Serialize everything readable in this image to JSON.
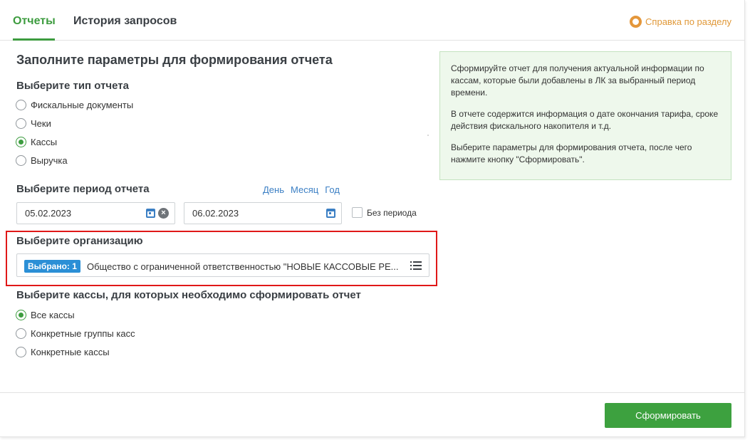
{
  "tabs": [
    {
      "label": "Отчеты",
      "active": true
    },
    {
      "label": "История запросов",
      "active": false
    }
  ],
  "help": {
    "label": "Справка по разделу",
    "icon": "lifebuoy-icon"
  },
  "form": {
    "title": "Заполните параметры для формирования отчета",
    "report_type": {
      "heading": "Выберите тип отчета",
      "options": [
        {
          "label": "Фискальные документы",
          "checked": false
        },
        {
          "label": "Чеки",
          "checked": false
        },
        {
          "label": "Кассы",
          "checked": true
        },
        {
          "label": "Выручка",
          "checked": false
        }
      ]
    },
    "period": {
      "heading": "Выберите период отчета",
      "quick_links": [
        "День",
        "Месяц",
        "Год"
      ],
      "date_from": "05.02.2023",
      "date_to": "06.02.2023",
      "no_period_label": "Без периода",
      "no_period_checked": false
    },
    "organization": {
      "heading": "Выберите организацию",
      "badge": "Выбрано: 1",
      "value": "Общество с ограниченной ответственностью \"НОВЫЕ КАССОВЫЕ РЕ..."
    },
    "registers": {
      "heading": "Выберите кассы, для которых необходимо сформировать отчет",
      "options": [
        {
          "label": "Все кассы",
          "checked": true
        },
        {
          "label": "Конкретные группы касс",
          "checked": false
        },
        {
          "label": "Конкретные кассы",
          "checked": false
        }
      ]
    }
  },
  "info_box": {
    "paragraphs": [
      "Сформируйте отчет для получения актуальной информации по кассам, которые были добавлены в ЛК за выбранный период времени.",
      "В отчете содержится информация о дате окончания тарифа, сроке действия фискального накопителя и т.д.",
      "Выберите параметры для формирования отчета, после чего нажмите кнопку \"Сформировать\"."
    ]
  },
  "submit_label": "Сформировать",
  "colors": {
    "accent": "#3d9c3f",
    "link": "#3b7fc4",
    "badge": "#2b8fd6",
    "highlight": "#e01818",
    "help": "#e09838"
  }
}
